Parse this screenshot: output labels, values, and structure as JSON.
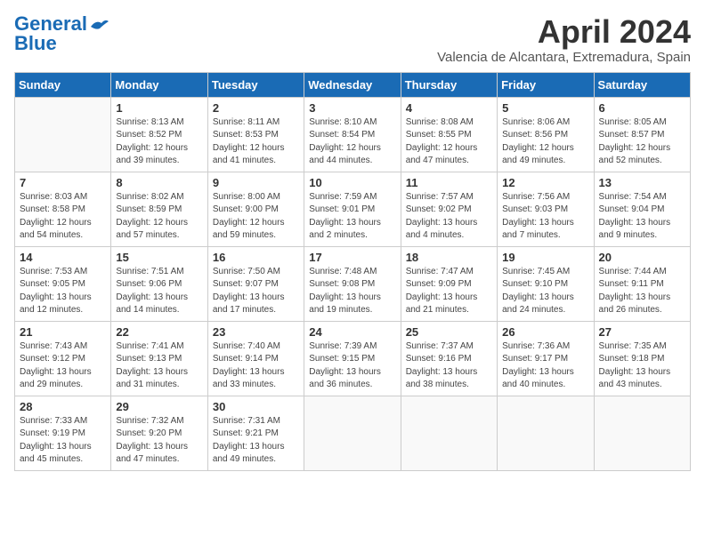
{
  "header": {
    "logo_line1": "General",
    "logo_line2": "Blue",
    "month_title": "April 2024",
    "location": "Valencia de Alcantara, Extremadura, Spain"
  },
  "weekdays": [
    "Sunday",
    "Monday",
    "Tuesday",
    "Wednesday",
    "Thursday",
    "Friday",
    "Saturday"
  ],
  "weeks": [
    [
      {
        "day": "",
        "empty": true
      },
      {
        "day": "1",
        "sunrise": "8:13 AM",
        "sunset": "8:52 PM",
        "daylight": "12 hours and 39 minutes."
      },
      {
        "day": "2",
        "sunrise": "8:11 AM",
        "sunset": "8:53 PM",
        "daylight": "12 hours and 41 minutes."
      },
      {
        "day": "3",
        "sunrise": "8:10 AM",
        "sunset": "8:54 PM",
        "daylight": "12 hours and 44 minutes."
      },
      {
        "day": "4",
        "sunrise": "8:08 AM",
        "sunset": "8:55 PM",
        "daylight": "12 hours and 47 minutes."
      },
      {
        "day": "5",
        "sunrise": "8:06 AM",
        "sunset": "8:56 PM",
        "daylight": "12 hours and 49 minutes."
      },
      {
        "day": "6",
        "sunrise": "8:05 AM",
        "sunset": "8:57 PM",
        "daylight": "12 hours and 52 minutes."
      }
    ],
    [
      {
        "day": "7",
        "sunrise": "8:03 AM",
        "sunset": "8:58 PM",
        "daylight": "12 hours and 54 minutes."
      },
      {
        "day": "8",
        "sunrise": "8:02 AM",
        "sunset": "8:59 PM",
        "daylight": "12 hours and 57 minutes."
      },
      {
        "day": "9",
        "sunrise": "8:00 AM",
        "sunset": "9:00 PM",
        "daylight": "12 hours and 59 minutes."
      },
      {
        "day": "10",
        "sunrise": "7:59 AM",
        "sunset": "9:01 PM",
        "daylight": "13 hours and 2 minutes."
      },
      {
        "day": "11",
        "sunrise": "7:57 AM",
        "sunset": "9:02 PM",
        "daylight": "13 hours and 4 minutes."
      },
      {
        "day": "12",
        "sunrise": "7:56 AM",
        "sunset": "9:03 PM",
        "daylight": "13 hours and 7 minutes."
      },
      {
        "day": "13",
        "sunrise": "7:54 AM",
        "sunset": "9:04 PM",
        "daylight": "13 hours and 9 minutes."
      }
    ],
    [
      {
        "day": "14",
        "sunrise": "7:53 AM",
        "sunset": "9:05 PM",
        "daylight": "13 hours and 12 minutes."
      },
      {
        "day": "15",
        "sunrise": "7:51 AM",
        "sunset": "9:06 PM",
        "daylight": "13 hours and 14 minutes."
      },
      {
        "day": "16",
        "sunrise": "7:50 AM",
        "sunset": "9:07 PM",
        "daylight": "13 hours and 17 minutes."
      },
      {
        "day": "17",
        "sunrise": "7:48 AM",
        "sunset": "9:08 PM",
        "daylight": "13 hours and 19 minutes."
      },
      {
        "day": "18",
        "sunrise": "7:47 AM",
        "sunset": "9:09 PM",
        "daylight": "13 hours and 21 minutes."
      },
      {
        "day": "19",
        "sunrise": "7:45 AM",
        "sunset": "9:10 PM",
        "daylight": "13 hours and 24 minutes."
      },
      {
        "day": "20",
        "sunrise": "7:44 AM",
        "sunset": "9:11 PM",
        "daylight": "13 hours and 26 minutes."
      }
    ],
    [
      {
        "day": "21",
        "sunrise": "7:43 AM",
        "sunset": "9:12 PM",
        "daylight": "13 hours and 29 minutes."
      },
      {
        "day": "22",
        "sunrise": "7:41 AM",
        "sunset": "9:13 PM",
        "daylight": "13 hours and 31 minutes."
      },
      {
        "day": "23",
        "sunrise": "7:40 AM",
        "sunset": "9:14 PM",
        "daylight": "13 hours and 33 minutes."
      },
      {
        "day": "24",
        "sunrise": "7:39 AM",
        "sunset": "9:15 PM",
        "daylight": "13 hours and 36 minutes."
      },
      {
        "day": "25",
        "sunrise": "7:37 AM",
        "sunset": "9:16 PM",
        "daylight": "13 hours and 38 minutes."
      },
      {
        "day": "26",
        "sunrise": "7:36 AM",
        "sunset": "9:17 PM",
        "daylight": "13 hours and 40 minutes."
      },
      {
        "day": "27",
        "sunrise": "7:35 AM",
        "sunset": "9:18 PM",
        "daylight": "13 hours and 43 minutes."
      }
    ],
    [
      {
        "day": "28",
        "sunrise": "7:33 AM",
        "sunset": "9:19 PM",
        "daylight": "13 hours and 45 minutes."
      },
      {
        "day": "29",
        "sunrise": "7:32 AM",
        "sunset": "9:20 PM",
        "daylight": "13 hours and 47 minutes."
      },
      {
        "day": "30",
        "sunrise": "7:31 AM",
        "sunset": "9:21 PM",
        "daylight": "13 hours and 49 minutes."
      },
      {
        "day": "",
        "empty": true
      },
      {
        "day": "",
        "empty": true
      },
      {
        "day": "",
        "empty": true
      },
      {
        "day": "",
        "empty": true
      }
    ]
  ]
}
